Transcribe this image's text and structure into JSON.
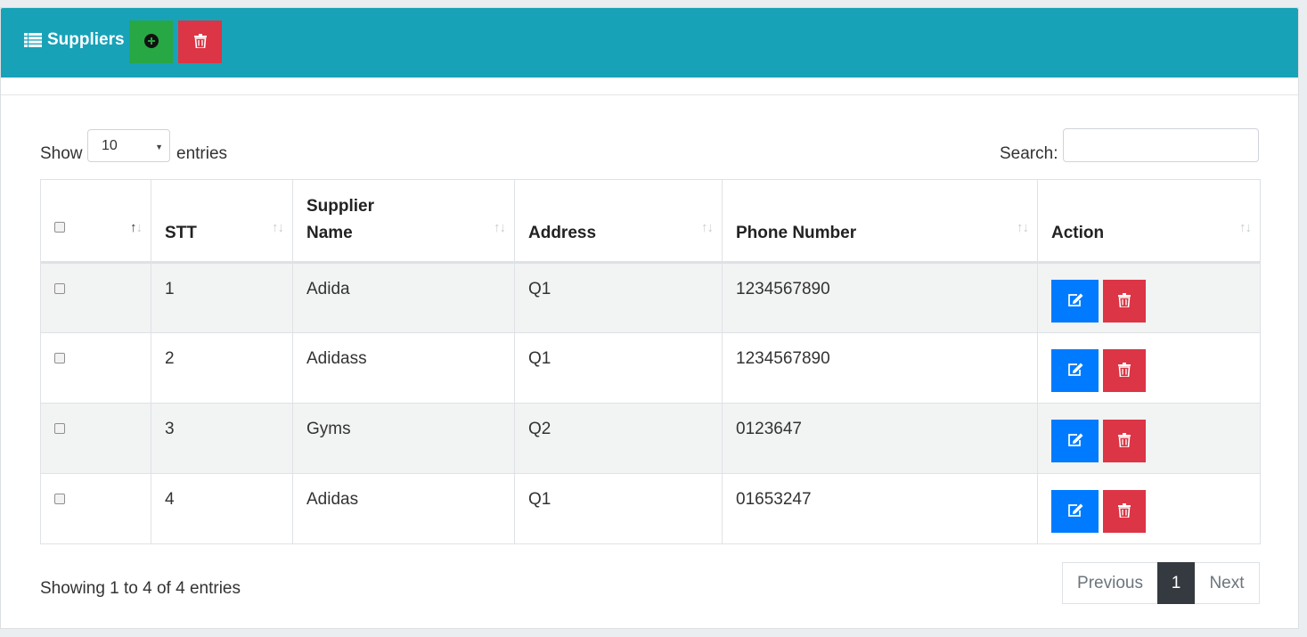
{
  "header": {
    "title": "Suppliers",
    "add_icon": "plus-circle-icon",
    "delete_icon": "trash-icon",
    "colors": {
      "header_bg": "#18a2b8",
      "add": "#28a745",
      "delete": "#dc3545",
      "edit": "#007bff"
    }
  },
  "length": {
    "show_label": "Show",
    "value": "10",
    "entries_label": "entries"
  },
  "search": {
    "label": "Search:",
    "value": ""
  },
  "table": {
    "columns": [
      "STT",
      "Supplier Name",
      "Address",
      "Phone Number",
      "Action"
    ],
    "rows": [
      {
        "stt": "1",
        "name": "Adida",
        "address": "Q1",
        "phone": "1234567890"
      },
      {
        "stt": "2",
        "name": "Adidass",
        "address": "Q1",
        "phone": "1234567890"
      },
      {
        "stt": "3",
        "name": "Gyms",
        "address": "Q2",
        "phone": "0123647"
      },
      {
        "stt": "4",
        "name": "Adidas",
        "address": "Q1",
        "phone": "01653247"
      }
    ]
  },
  "footer": {
    "info": "Showing 1 to 4 of 4 entries",
    "previous": "Previous",
    "page": "1",
    "next": "Next"
  }
}
